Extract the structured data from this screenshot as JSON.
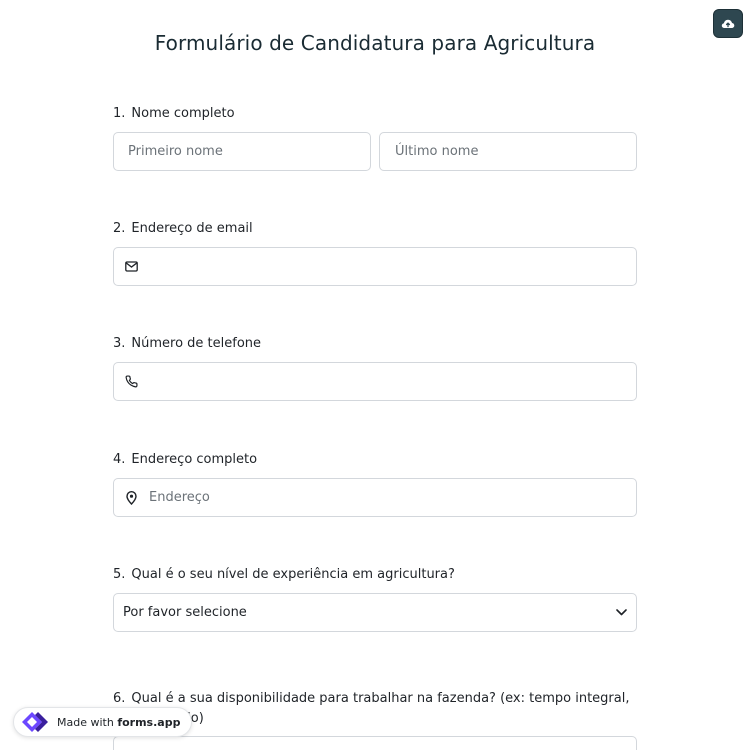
{
  "page": {
    "title": "Formulário de Candidatura para Agricultura"
  },
  "questions": {
    "q1": {
      "number": "1.",
      "label": "Nome completo",
      "first_placeholder": "Primeiro nome",
      "last_placeholder": "Último nome"
    },
    "q2": {
      "number": "2.",
      "label": "Endereço de email",
      "value": "",
      "icon": "mail-icon"
    },
    "q3": {
      "number": "3.",
      "label": "Número de telefone",
      "value": "",
      "icon": "phone-icon"
    },
    "q4": {
      "number": "4.",
      "label": "Endereço completo",
      "placeholder": "Endereço",
      "icon": "map-pin-icon"
    },
    "q5": {
      "number": "5.",
      "label": "Qual é o seu nível de experiência em agricultura?",
      "selected": "Por favor selecione"
    },
    "q6": {
      "number": "6.",
      "label": "Qual é a sua disponibilidade para trabalhar na fazenda? (ex: tempo integral, meio período)"
    }
  },
  "badge": {
    "prefix": "Made with",
    "brand": "forms.app"
  },
  "colors": {
    "save_button": "#2e4750",
    "border": "#d3d7dc",
    "placeholder": "#6b7278",
    "logo_purple": "#6c47ff"
  }
}
